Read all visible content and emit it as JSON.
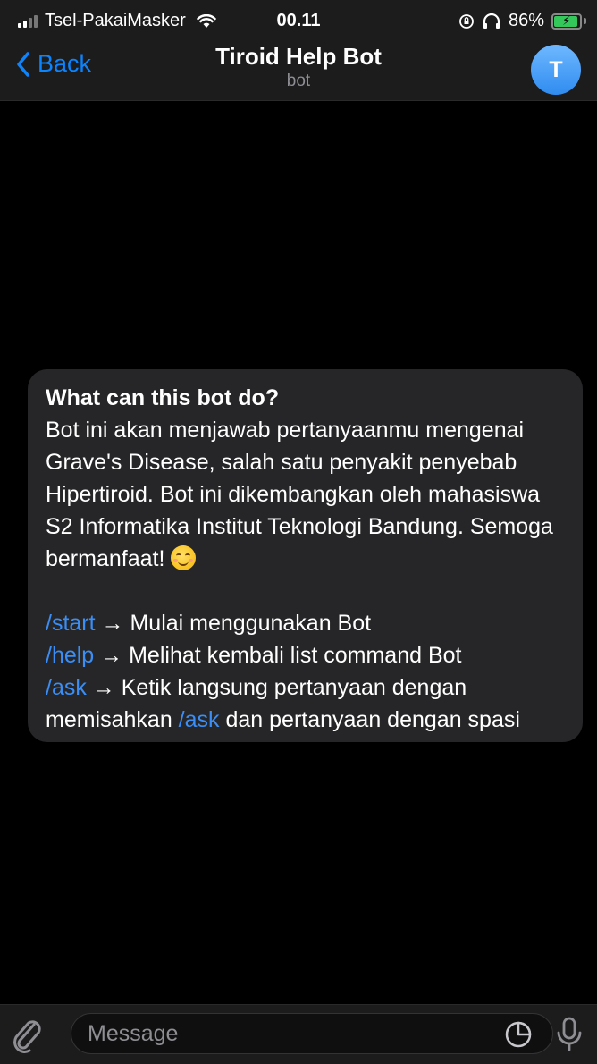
{
  "status_bar": {
    "carrier": "Tsel-PakaiMasker",
    "time": "00.11",
    "battery_text": "86%",
    "battery_level": 0.86
  },
  "header": {
    "back_label": "Back",
    "title": "Tiroid Help Bot",
    "subtitle": "bot",
    "avatar_initial": "T"
  },
  "bot_info": {
    "heading": "What can this bot do?",
    "description": "Bot ini akan menjawab pertanyaanmu mengenai Grave's Disease, salah satu penyakit penyebab Hipertiroid. Bot ini dikembangkan oleh mahasiswa S2 Informatika Institut Teknologi Bandung. Semoga bermanfaat!",
    "description_emoji": "smiling-face-emoji",
    "commands": [
      {
        "command": "/start",
        "text": " → Mulai menggunakan Bot"
      },
      {
        "command": "/help",
        "text": " → Melihat kembali list command Bot"
      },
      {
        "command": "/ask",
        "text": " → Ketik langsung pertanyaan dengan memisahkan ",
        "inline_command": "/ask",
        "text_after": " dan pertanyaan dengan spasi"
      }
    ]
  },
  "composer": {
    "placeholder": "Message",
    "value": ""
  },
  "colors": {
    "accent": "#0a84ff",
    "command_link": "#3a8ef6",
    "bubble": "#262628",
    "bar": "#1c1c1d"
  }
}
